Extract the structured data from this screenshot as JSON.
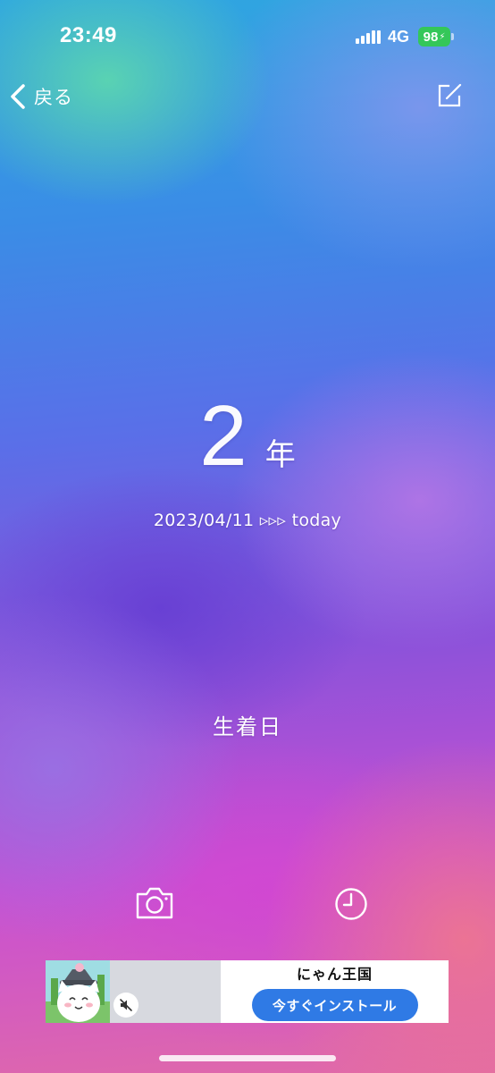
{
  "status_bar": {
    "time": "23:49",
    "network": "4G",
    "battery_level": "98",
    "battery_color": "#34c759",
    "icons": [
      "signal-icon",
      "battery-icon",
      "charging-bolt-icon"
    ]
  },
  "nav": {
    "back_label": "戻る",
    "back_icon": "chevron-left-icon",
    "edit_icon": "edit-icon"
  },
  "counter": {
    "value": "2",
    "unit": "年",
    "date_range": "2023/04/11 ▹▹▹ today"
  },
  "event": {
    "title": "生着日"
  },
  "actions": {
    "camera_icon": "camera-icon",
    "history_icon": "clock-icon"
  },
  "ad": {
    "title": "にゃん王国",
    "install_label": "今すぐインストール",
    "install_color": "#2f7ae5",
    "mute_icon": "speaker-muted-icon"
  }
}
